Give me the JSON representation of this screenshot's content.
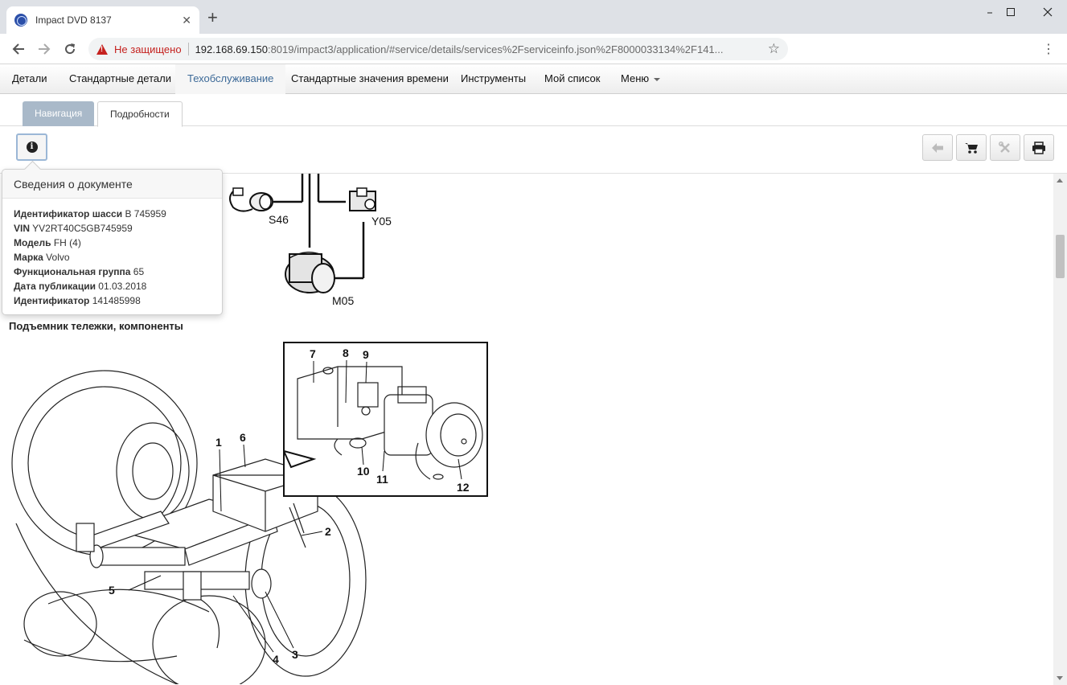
{
  "browser": {
    "tab_title": "Impact DVD 8137",
    "tab_close": "✕",
    "new_tab": "+",
    "security_label": "Не защищено",
    "url_host": "192.168.69.150",
    "url_rest": ":8019/impact3/application/#service/details/services%2Fserviceinfo.json%2F8000033134%2F141...",
    "icons": [
      "favicon-globe-icon",
      "back-arrow-icon",
      "forward-arrow-icon",
      "reload-icon",
      "warning-icon",
      "star-icon",
      "kebab-menu-icon",
      "minimize-icon",
      "maximize-icon",
      "close-icon"
    ]
  },
  "nav": {
    "items": [
      {
        "label": "Детали"
      },
      {
        "label": "Стандартные детали"
      },
      {
        "label": "Техобслуживание"
      },
      {
        "label": "Стандартные значения времени"
      },
      {
        "label": "Инструменты"
      },
      {
        "label": "Мой список"
      },
      {
        "label": "Меню"
      }
    ],
    "active": "Техобслуживание"
  },
  "subtabs": {
    "navigation": "Навигация",
    "details": "Подробности"
  },
  "toolbar": {
    "icons": [
      "info-icon",
      "arrow-left-icon",
      "cart-icon",
      "tools-icon",
      "print-icon"
    ]
  },
  "doc_info": {
    "title": "Сведения о документе",
    "fields": [
      {
        "label": "Идентификатор шасси",
        "value": "B 745959"
      },
      {
        "label": "VIN",
        "value": "YV2RT40C5GB745959"
      },
      {
        "label": "Модель",
        "value": "FH (4)"
      },
      {
        "label": "Марка",
        "value": "Volvo"
      },
      {
        "label": "Функциональная группа",
        "value": "65"
      },
      {
        "label": "Дата публикации",
        "value": "01.03.2018"
      },
      {
        "label": "Идентификатор",
        "value": "141485998"
      }
    ]
  },
  "diagram_top": {
    "labels": [
      "S46",
      "Y05",
      "M05"
    ]
  },
  "section": {
    "title": "Подъемник тележки, компоненты"
  },
  "diagram_main": {
    "callouts": [
      "1",
      "2",
      "3",
      "4",
      "5",
      "6",
      "7",
      "8",
      "9",
      "10",
      "11",
      "12"
    ]
  }
}
